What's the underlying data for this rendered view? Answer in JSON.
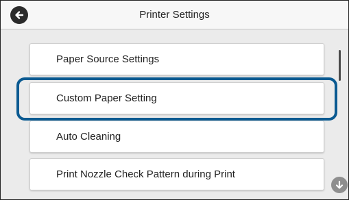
{
  "header": {
    "title": "Printer Settings",
    "back_icon": "arrow-left-circle-icon"
  },
  "menu": {
    "items": [
      {
        "label": "Paper Source Settings"
      },
      {
        "label": "Custom Paper Setting",
        "selected": true
      },
      {
        "label": "Auto Cleaning"
      },
      {
        "label": "Print Nozzle Check Pattern during Print"
      }
    ]
  },
  "scroll": {
    "down_icon": "arrow-down-circle-icon"
  },
  "colors": {
    "highlight": "#0a5a91",
    "header_bg": "#f7f7f7",
    "list_bg": "#ebebeb"
  }
}
